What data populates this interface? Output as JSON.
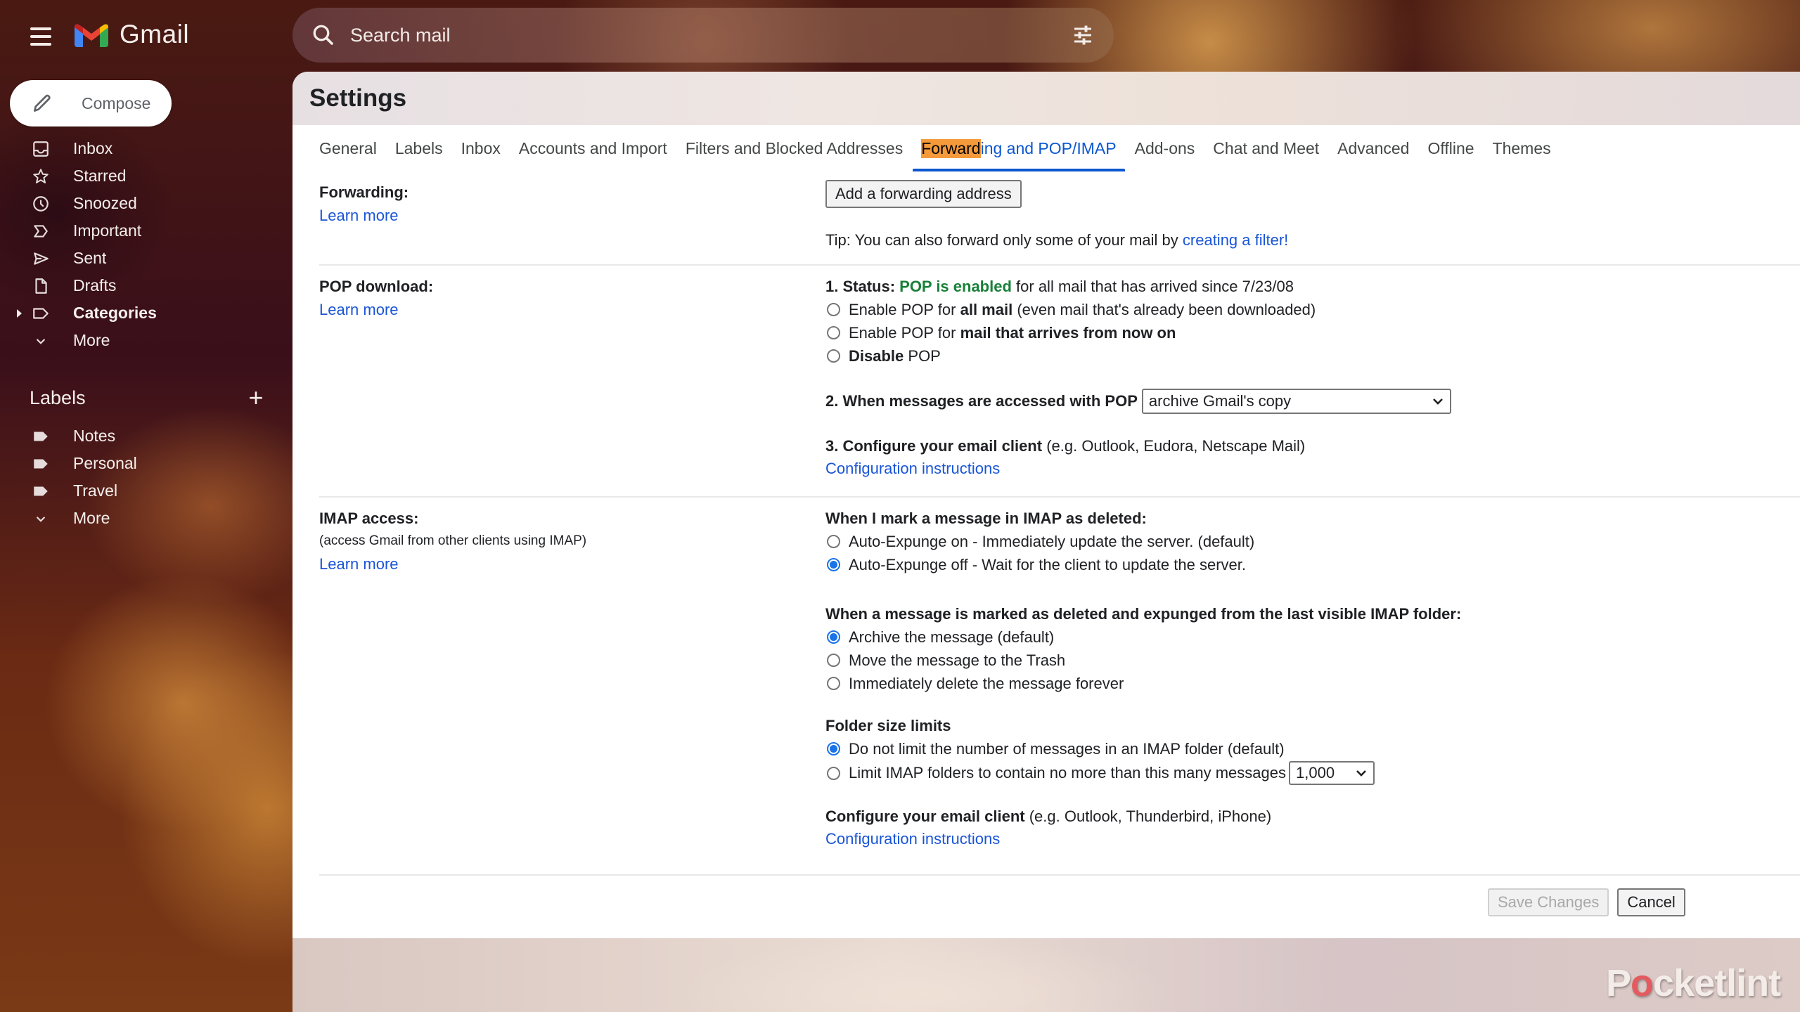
{
  "app": {
    "name": "Gmail"
  },
  "search": {
    "placeholder": "Search mail"
  },
  "compose": {
    "label": "Compose"
  },
  "sidebar": {
    "items": [
      {
        "label": "Inbox",
        "icon": "inbox-icon"
      },
      {
        "label": "Starred",
        "icon": "star-icon"
      },
      {
        "label": "Snoozed",
        "icon": "clock-icon"
      },
      {
        "label": "Important",
        "icon": "important-icon"
      },
      {
        "label": "Sent",
        "icon": "send-icon"
      },
      {
        "label": "Drafts",
        "icon": "draft-icon"
      },
      {
        "label": "Categories",
        "icon": "label-outline-icon"
      },
      {
        "label": "More",
        "icon": "chevron-down-icon"
      }
    ],
    "labels_title": "Labels",
    "labels_add": "+",
    "labels": [
      {
        "label": "Notes"
      },
      {
        "label": "Personal"
      },
      {
        "label": "Travel"
      },
      {
        "label": "More"
      }
    ]
  },
  "settings": {
    "title": "Settings",
    "tabs": [
      {
        "label": "General"
      },
      {
        "label": "Labels"
      },
      {
        "label": "Inbox"
      },
      {
        "label": "Accounts and Import"
      },
      {
        "label": "Filters and Blocked Addresses"
      },
      {
        "label_highlight": "Forward",
        "label_rest": "ing and POP/IMAP",
        "active": true
      },
      {
        "label": "Add-ons"
      },
      {
        "label": "Chat and Meet"
      },
      {
        "label": "Advanced"
      },
      {
        "label": "Offline"
      },
      {
        "label": "Themes"
      }
    ],
    "forwarding": {
      "title": "Forwarding:",
      "learn_more": "Learn more",
      "add_button": "Add a forwarding address",
      "tip_prefix": "Tip: You can also forward only some of your mail by ",
      "tip_link": "creating a filter!"
    },
    "pop": {
      "title": "POP download:",
      "learn_more": "Learn more",
      "status_prefix": "1. Status: ",
      "status_value": "POP is enabled",
      "status_suffix": " for all mail that has arrived since 7/23/08",
      "options": [
        {
          "pre": "Enable POP for ",
          "bold": "all mail",
          "post": " (even mail that's already been downloaded)",
          "checked": false
        },
        {
          "pre": "Enable POP for ",
          "bold": "mail that arrives from now on",
          "post": "",
          "checked": false
        },
        {
          "pre": "",
          "bold": "Disable",
          "post": " POP",
          "checked": false
        }
      ],
      "access_label": "2. When messages are accessed with POP",
      "access_selected": "archive Gmail's copy",
      "configure_bold": "3. Configure your email client",
      "configure_rest": " (e.g. Outlook, Eudora, Netscape Mail)",
      "config_link": "Configuration instructions"
    },
    "imap": {
      "title": "IMAP access:",
      "subtitle": "(access Gmail from other clients using IMAP)",
      "learn_more": "Learn more",
      "deleted_heading": "When I mark a message in IMAP as deleted:",
      "deleted_options": [
        {
          "label": "Auto-Expunge on - Immediately update the server. (default)",
          "checked": false
        },
        {
          "label": "Auto-Expunge off - Wait for the client to update the server.",
          "checked": true
        }
      ],
      "expunged_heading": "When a message is marked as deleted and expunged from the last visible IMAP folder:",
      "expunged_options": [
        {
          "label": "Archive the message (default)",
          "checked": true
        },
        {
          "label": "Move the message to the Trash",
          "checked": false
        },
        {
          "label": "Immediately delete the message forever",
          "checked": false
        }
      ],
      "folder_heading": "Folder size limits",
      "folder_options": [
        {
          "label": "Do not limit the number of messages in an IMAP folder (default)",
          "checked": true
        },
        {
          "label": "Limit IMAP folders to contain no more than this many messages",
          "checked": false
        }
      ],
      "folder_limit_selected": "1,000",
      "configure_bold": "Configure your email client",
      "configure_rest": " (e.g. Outlook, Thunderbird, iPhone)",
      "config_link": "Configuration instructions"
    },
    "actions": {
      "save": "Save Changes",
      "cancel": "Cancel"
    }
  },
  "watermark": {
    "pre": "P",
    "o": "o",
    "post": "cketlint"
  },
  "colors": {
    "accent": "#0b57d0",
    "link": "#1a55d6",
    "pop_enabled": "#188038",
    "highlight": "#f59a3a",
    "radio_checked": "#1a73e8"
  }
}
